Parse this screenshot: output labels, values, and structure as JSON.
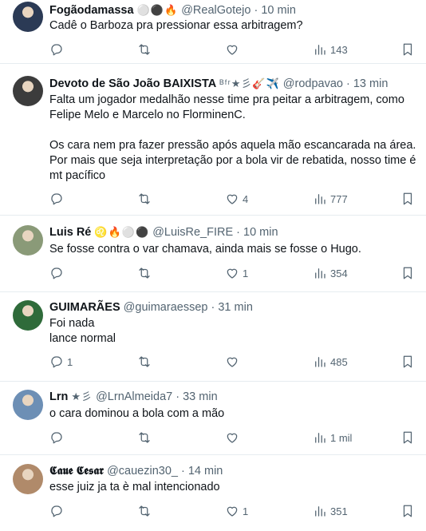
{
  "tweets": [
    {
      "name": "Fogãodamassa",
      "badges": "⚪⚫🔥",
      "handle": "@RealGotejo",
      "time": "· 10 min",
      "text": "Cadê o Barboza pra pressionar essa arbitragem?",
      "replies": "",
      "retweets": "",
      "likes": "",
      "views": "143",
      "avatar_color": "#2b3a55"
    },
    {
      "name": "Devoto de São João BAIXISTA",
      "badges": "ᴮᶠʳ★彡🎸✈️",
      "handle": "@rodpavao",
      "time": "· 13 min",
      "text": "Falta um jogador medalhão nesse time pra peitar a arbitragem, como Felipe Melo e Marcelo no FlorminenC.\n\nOs cara nem pra fazer pressão após aquela mão escancarada na área. Por mais que seja interpretação por a bola vir de rebatida, nosso time é mt pacífico",
      "replies": "",
      "retweets": "",
      "likes": "4",
      "views": "777",
      "avatar_color": "#3c3c3c"
    },
    {
      "name": "Luis Ré",
      "badges": "♌🔥⚪⚫",
      "handle": "@LuisRe_FIRE",
      "time": "· 10 min",
      "text": "Se fosse contra o var chamava, ainda mais se fosse o Hugo.",
      "replies": "",
      "retweets": "",
      "likes": "1",
      "views": "354",
      "avatar_color": "#8a9a78"
    },
    {
      "name": "GUIMARÃES",
      "badges": "",
      "handle": "@guimaraessep",
      "time": "· 31 min",
      "text": "Foi nada\nlance normal",
      "replies": "1",
      "retweets": "",
      "likes": "",
      "views": "485",
      "avatar_color": "#2f6b3a"
    },
    {
      "name": "Lrn",
      "badges": "★彡",
      "handle": "@LrnAlmeida7",
      "time": "· 33 min",
      "text": "o cara dominou a bola com a mão",
      "replies": "",
      "retweets": "",
      "likes": "",
      "views": "1 mil",
      "avatar_color": "#6d8fb5"
    },
    {
      "name": "𝕮𝖆𝖚𝖊 𝕮𝖊𝖘𝖆𝖗",
      "badges": "",
      "handle": "@cauezin30_",
      "time": "· 14 min",
      "text": "esse juiz ja ta è mal intencionado",
      "replies": "",
      "retweets": "",
      "likes": "1",
      "views": "351",
      "avatar_color": "#b08a6a"
    }
  ]
}
